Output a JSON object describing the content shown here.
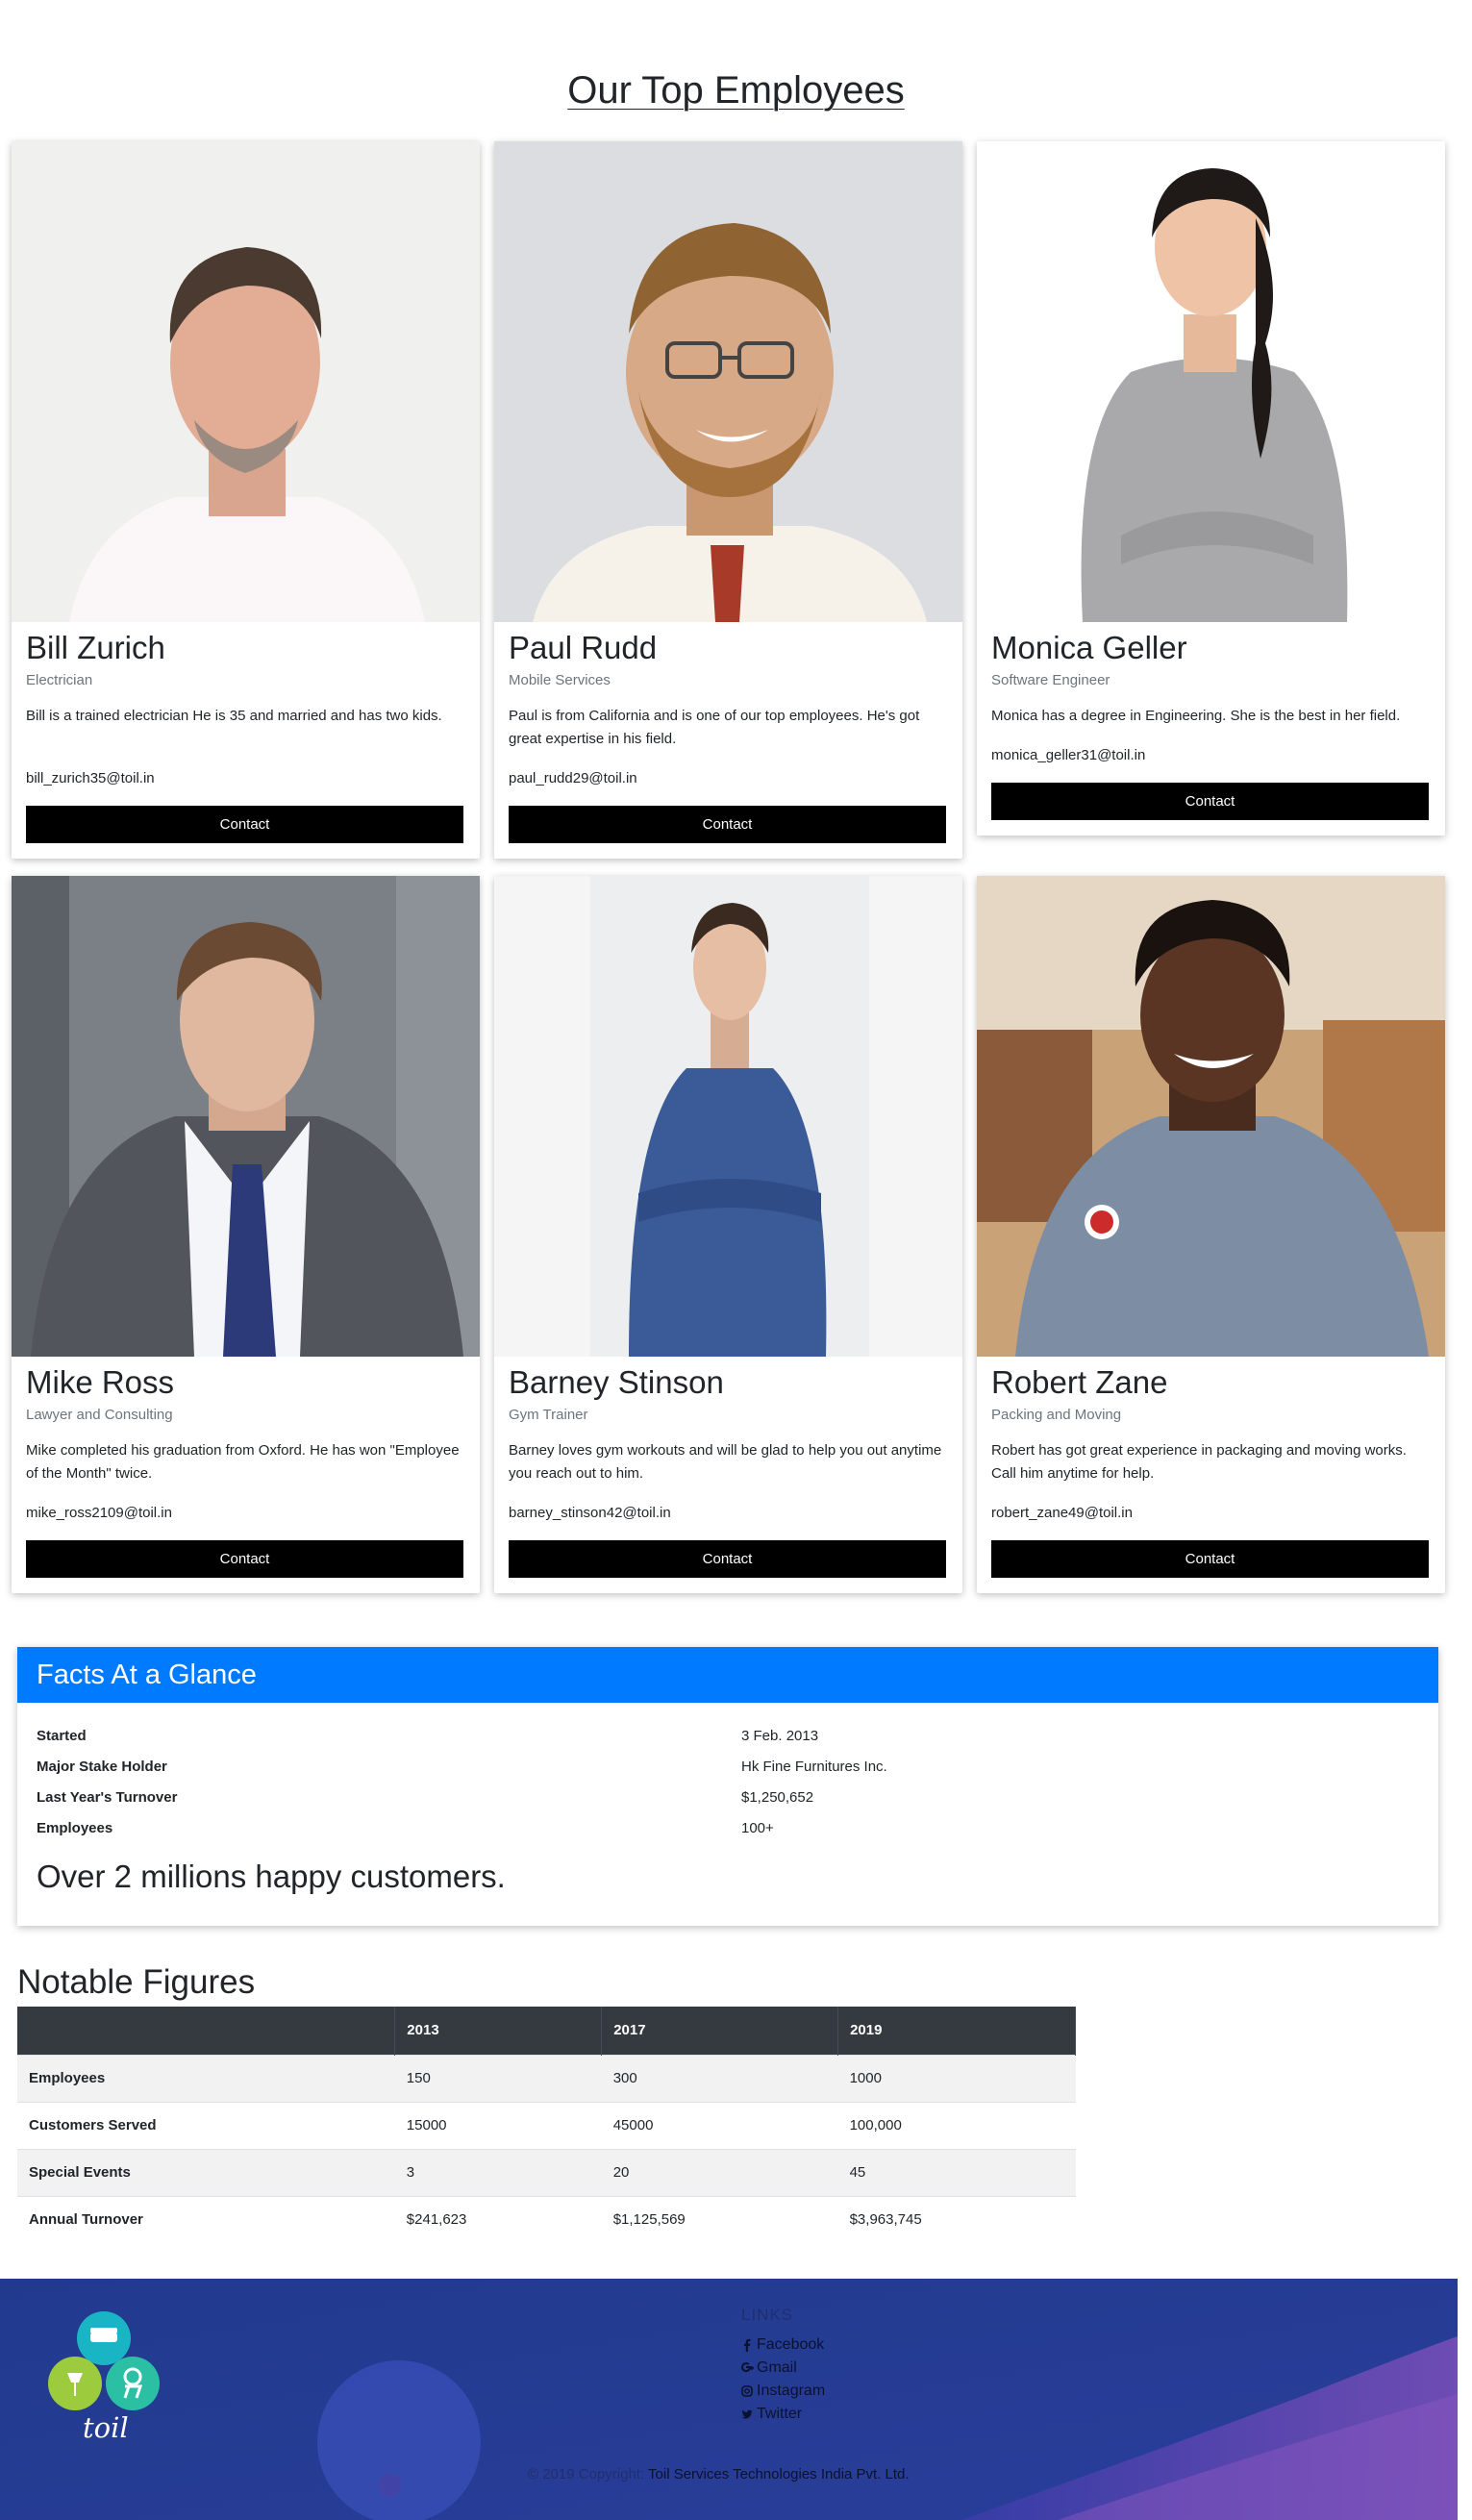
{
  "page": {
    "title": "Our Top Employees"
  },
  "employees": [
    {
      "name": "Bill Zurich",
      "role": "Electrician",
      "description": "Bill is a trained electrician He is 35 and married and has two kids.",
      "email": "bill_zurich35@toil.in",
      "button": "Contact"
    },
    {
      "name": "Paul Rudd",
      "role": "Mobile Services",
      "description": "Paul is from California and is one of our top employees. He's got great expertise in his field.",
      "email": "paul_rudd29@toil.in",
      "button": "Contact"
    },
    {
      "name": "Monica Geller",
      "role": "Software Engineer",
      "description": "Monica has a degree in Engineering. She is the best in her field.",
      "email": "monica_geller31@toil.in",
      "button": "Contact"
    },
    {
      "name": "Mike Ross",
      "role": "Lawyer and Consulting",
      "description": "Mike completed his graduation from Oxford. He has won \"Employee of the Month\" twice.",
      "email": "mike_ross2109@toil.in",
      "button": "Contact"
    },
    {
      "name": "Barney Stinson",
      "role": "Gym Trainer",
      "description": "Barney loves gym workouts and will be glad to help you out anytime you reach out to him.",
      "email": "barney_stinson42@toil.in",
      "button": "Contact"
    },
    {
      "name": "Robert Zane",
      "role": "Packing and Moving",
      "description": "Robert has got great experience in packaging and moving works. Call him anytime for help.",
      "email": "robert_zane49@toil.in",
      "button": "Contact"
    }
  ],
  "facts": {
    "title": "Facts At a Glance",
    "rows": [
      {
        "label": "Started",
        "value": "3 Feb. 2013"
      },
      {
        "label": "Major Stake Holder",
        "value": "Hk Fine Furnitures Inc."
      },
      {
        "label": "Last Year's Turnover",
        "value": "$1,250,652"
      },
      {
        "label": "Employees",
        "value": "100+"
      }
    ],
    "highlight": "Over 2 millions happy customers."
  },
  "notable": {
    "title": "Notable Figures",
    "headers": [
      "",
      "2013",
      "2017",
      "2019"
    ],
    "rows": [
      [
        "Employees",
        "150",
        "300",
        "1000"
      ],
      [
        "Customers Served",
        "15000",
        "45000",
        "100,000"
      ],
      [
        "Special Events",
        "3",
        "20",
        "45"
      ],
      [
        "Annual Turnover",
        "$241,623",
        "$1,125,569",
        "$3,963,745"
      ]
    ]
  },
  "footer": {
    "brand": "toil",
    "links_title": "LINKS",
    "links": [
      {
        "label": "Facebook",
        "icon": "facebook-icon"
      },
      {
        "label": "Gmail",
        "icon": "google-plus-icon"
      },
      {
        "label": "Instagram",
        "icon": "instagram-icon"
      },
      {
        "label": "Twitter",
        "icon": "twitter-icon"
      }
    ],
    "copyright_prefix": "© 2019 Copyright:",
    "copyright_company": "Toil Services Technologies India Pvt. Ltd."
  }
}
